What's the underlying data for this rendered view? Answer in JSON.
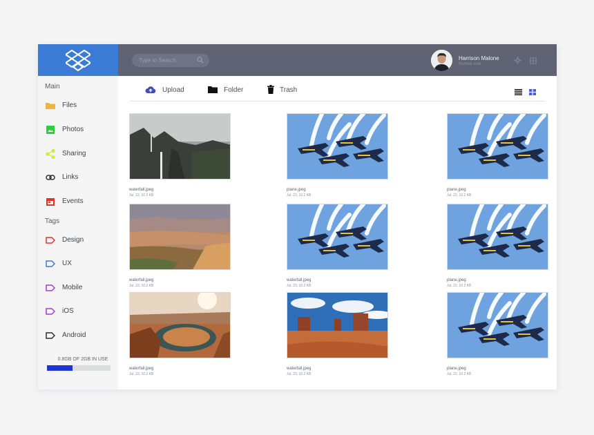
{
  "header": {
    "search_placeholder": "Type to Search",
    "user_name": "Harrison Malone",
    "user_role": "Normal user"
  },
  "sidebar": {
    "main_heading": "Main",
    "main_items": [
      {
        "label": "Files",
        "icon": "folder-icon",
        "color": "#f2b53a"
      },
      {
        "label": "Photos",
        "icon": "image-icon",
        "color": "#2ecc40"
      },
      {
        "label": "Sharing",
        "icon": "share-icon",
        "color": "#d7e83a"
      },
      {
        "label": "Links",
        "icon": "link-icon",
        "color": "#2a2d33"
      },
      {
        "label": "Events",
        "icon": "calendar-icon",
        "color": "#e8302a"
      }
    ],
    "tags_heading": "Tags",
    "tags": [
      {
        "label": "Design",
        "color": "#e8302a"
      },
      {
        "label": "UX",
        "color": "#3a7bd5"
      },
      {
        "label": "Mobile",
        "color": "#a43ad5"
      },
      {
        "label": "iOS",
        "color": "#a43ad5"
      },
      {
        "label": "Android",
        "color": "#2a2d33"
      }
    ],
    "storage_text": "0.8GB OF 2GB IN USE",
    "storage_fraction": 0.4
  },
  "toolbar": {
    "upload_label": "Upload",
    "folder_label": "Folder",
    "trash_label": "Trash"
  },
  "files": [
    {
      "name": "waterfall.jpeg",
      "meta": "Jul, 22, 10.2 KB",
      "image": "waterfall"
    },
    {
      "name": "plane.jpeg",
      "meta": "Jul, 23, 10.2 KB",
      "image": "jets"
    },
    {
      "name": "plane.jpeg",
      "meta": "Jul, 22, 10.2 KB",
      "image": "jets"
    },
    {
      "name": "waterfall.jpeg",
      "meta": "Jul, 22, 10.2 KB",
      "image": "canyon"
    },
    {
      "name": "waterfall.jpeg",
      "meta": "Jul, 23, 10.2 KB",
      "image": "jets"
    },
    {
      "name": "plane.jpeg",
      "meta": "Jul, 22, 10.2 KB",
      "image": "jets"
    },
    {
      "name": "waterfall.jpeg",
      "meta": "Jul, 22, 10.2 KB",
      "image": "horseshoe"
    },
    {
      "name": "waterfall.jpeg",
      "meta": "Jul, 23, 10.2 KB",
      "image": "desert"
    },
    {
      "name": "plane.jpeg",
      "meta": "Jul, 22, 10.2 KB",
      "image": "jets"
    }
  ]
}
